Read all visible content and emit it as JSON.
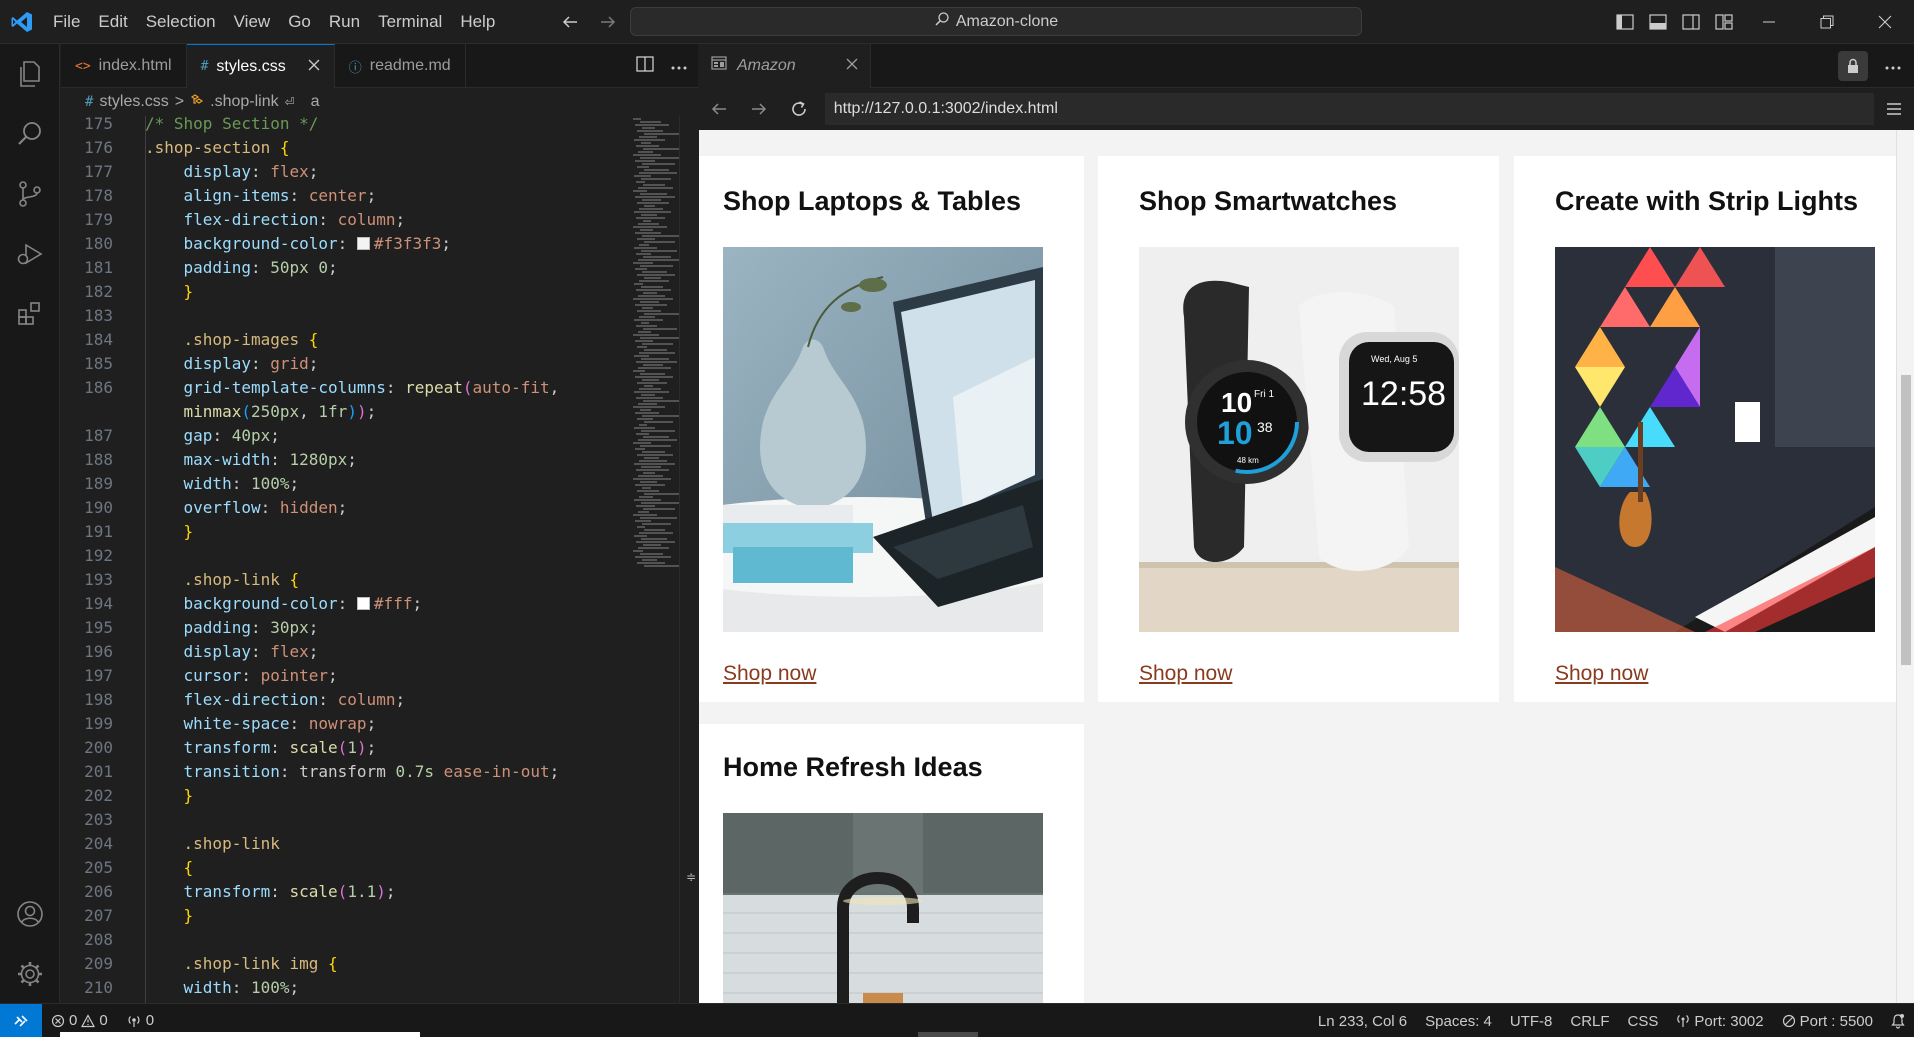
{
  "window": {
    "menu": [
      "File",
      "Edit",
      "Selection",
      "View",
      "Go",
      "Run",
      "Terminal",
      "Help"
    ],
    "search_text": "Amazon-clone"
  },
  "editor": {
    "tabs": [
      {
        "glyph": "<>",
        "label": "index.html",
        "color": "#e37933",
        "active": false
      },
      {
        "glyph": "#",
        "label": "styles.css",
        "color": "#519aba",
        "active": true
      },
      {
        "glyph": "ⓘ",
        "label": "readme.md",
        "color": "#519aba",
        "active": false
      }
    ],
    "breadcrumb": {
      "file": "styles.css",
      "sep": ">",
      "symbol": ".shop-link",
      "element": "a"
    },
    "lines": [
      {
        "n": "175",
        "tokens": [
          [
            "c-cm",
            "/* Shop Section */"
          ]
        ]
      },
      {
        "n": "176",
        "tokens": [
          [
            "c-sel",
            ".shop-section"
          ],
          [
            "c-pun",
            " "
          ],
          [
            "c-br",
            "{"
          ]
        ]
      },
      {
        "n": "177",
        "tokens": [
          [
            "c-prop",
            "    display"
          ],
          [
            "c-pun",
            ": "
          ],
          [
            "c-val",
            "flex"
          ],
          [
            "c-pun",
            ";"
          ]
        ]
      },
      {
        "n": "178",
        "tokens": [
          [
            "c-prop",
            "    align-items"
          ],
          [
            "c-pun",
            ": "
          ],
          [
            "c-val",
            "center"
          ],
          [
            "c-pun",
            ";"
          ]
        ]
      },
      {
        "n": "179",
        "tokens": [
          [
            "c-prop",
            "    flex-direction"
          ],
          [
            "c-pun",
            ": "
          ],
          [
            "c-val",
            "column"
          ],
          [
            "c-pun",
            ";"
          ]
        ]
      },
      {
        "n": "180",
        "tokens": [
          [
            "c-prop",
            "    background-color"
          ],
          [
            "c-pun",
            ": "
          ],
          [
            "swatch",
            "#f3f3f3"
          ],
          [
            "c-val",
            "#f3f3f3"
          ],
          [
            "c-pun",
            ";"
          ]
        ]
      },
      {
        "n": "181",
        "tokens": [
          [
            "c-prop",
            "    padding"
          ],
          [
            "c-pun",
            ": "
          ],
          [
            "c-num",
            "50px 0"
          ],
          [
            "c-pun",
            ";"
          ]
        ]
      },
      {
        "n": "182",
        "tokens": [
          [
            "c-br",
            "    }"
          ]
        ]
      },
      {
        "n": "183",
        "tokens": []
      },
      {
        "n": "184",
        "tokens": [
          [
            "c-sel",
            "    .shop-images"
          ],
          [
            "c-pun",
            " "
          ],
          [
            "c-br",
            "{"
          ]
        ]
      },
      {
        "n": "185",
        "tokens": [
          [
            "c-prop",
            "    display"
          ],
          [
            "c-pun",
            ": "
          ],
          [
            "c-val",
            "grid"
          ],
          [
            "c-pun",
            ";"
          ]
        ]
      },
      {
        "n": "186",
        "tokens": [
          [
            "c-prop",
            "    grid-template-columns"
          ],
          [
            "c-pun",
            ": "
          ],
          [
            "c-fn",
            "repeat"
          ],
          [
            "c-br2",
            "("
          ],
          [
            "c-val",
            "auto-fit"
          ],
          [
            "c-pun",
            ","
          ]
        ]
      },
      {
        "n": "",
        "tokens": [
          [
            "c-fn",
            "    minmax"
          ],
          [
            "c-br3",
            "("
          ],
          [
            "c-num",
            "250px"
          ],
          [
            "c-pun",
            ", "
          ],
          [
            "c-num",
            "1fr"
          ],
          [
            "c-br3",
            ")"
          ],
          [
            "c-br2",
            ")"
          ],
          [
            "c-pun",
            ";"
          ]
        ]
      },
      {
        "n": "187",
        "tokens": [
          [
            "c-prop",
            "    gap"
          ],
          [
            "c-pun",
            ": "
          ],
          [
            "c-num",
            "40px"
          ],
          [
            "c-pun",
            ";"
          ]
        ]
      },
      {
        "n": "188",
        "tokens": [
          [
            "c-prop",
            "    max-width"
          ],
          [
            "c-pun",
            ": "
          ],
          [
            "c-num",
            "1280px"
          ],
          [
            "c-pun",
            ";"
          ]
        ]
      },
      {
        "n": "189",
        "tokens": [
          [
            "c-prop",
            "    width"
          ],
          [
            "c-pun",
            ": "
          ],
          [
            "c-num",
            "100%"
          ],
          [
            "c-pun",
            ";"
          ]
        ]
      },
      {
        "n": "190",
        "tokens": [
          [
            "c-prop",
            "    overflow"
          ],
          [
            "c-pun",
            ": "
          ],
          [
            "c-val",
            "hidden"
          ],
          [
            "c-pun",
            ";"
          ]
        ]
      },
      {
        "n": "191",
        "tokens": [
          [
            "c-br",
            "    }"
          ]
        ]
      },
      {
        "n": "192",
        "tokens": []
      },
      {
        "n": "193",
        "tokens": [
          [
            "c-sel",
            "    .shop-link"
          ],
          [
            "c-pun",
            " "
          ],
          [
            "c-br",
            "{"
          ]
        ]
      },
      {
        "n": "194",
        "tokens": [
          [
            "c-prop",
            "    background-color"
          ],
          [
            "c-pun",
            ": "
          ],
          [
            "swatch",
            "#ffffff"
          ],
          [
            "c-val",
            "#fff"
          ],
          [
            "c-pun",
            ";"
          ]
        ]
      },
      {
        "n": "195",
        "tokens": [
          [
            "c-prop",
            "    padding"
          ],
          [
            "c-pun",
            ": "
          ],
          [
            "c-num",
            "30px"
          ],
          [
            "c-pun",
            ";"
          ]
        ]
      },
      {
        "n": "196",
        "tokens": [
          [
            "c-prop",
            "    display"
          ],
          [
            "c-pun",
            ": "
          ],
          [
            "c-val",
            "flex"
          ],
          [
            "c-pun",
            ";"
          ]
        ]
      },
      {
        "n": "197",
        "tokens": [
          [
            "c-prop",
            "    cursor"
          ],
          [
            "c-pun",
            ": "
          ],
          [
            "c-val",
            "pointer"
          ],
          [
            "c-pun",
            ";"
          ]
        ]
      },
      {
        "n": "198",
        "tokens": [
          [
            "c-prop",
            "    flex-direction"
          ],
          [
            "c-pun",
            ": "
          ],
          [
            "c-val",
            "column"
          ],
          [
            "c-pun",
            ";"
          ]
        ]
      },
      {
        "n": "199",
        "tokens": [
          [
            "c-prop",
            "    white-space"
          ],
          [
            "c-pun",
            ": "
          ],
          [
            "c-val",
            "nowrap"
          ],
          [
            "c-pun",
            ";"
          ]
        ]
      },
      {
        "n": "200",
        "tokens": [
          [
            "c-prop",
            "    transform"
          ],
          [
            "c-pun",
            ": "
          ],
          [
            "c-fn",
            "scale"
          ],
          [
            "c-br2",
            "("
          ],
          [
            "c-num",
            "1"
          ],
          [
            "c-br2",
            ")"
          ],
          [
            "c-pun",
            ";"
          ]
        ]
      },
      {
        "n": "201",
        "tokens": [
          [
            "c-prop",
            "    transition"
          ],
          [
            "c-pun",
            ": transform "
          ],
          [
            "c-num",
            "0.7s"
          ],
          [
            "c-pun",
            " "
          ],
          [
            "c-val",
            "ease-in-out"
          ],
          [
            "c-pun",
            ";"
          ]
        ]
      },
      {
        "n": "202",
        "tokens": [
          [
            "c-br",
            "    }"
          ]
        ]
      },
      {
        "n": "203",
        "tokens": []
      },
      {
        "n": "204",
        "tokens": [
          [
            "c-sel",
            "    .shop-link"
          ]
        ]
      },
      {
        "n": "205",
        "tokens": [
          [
            "c-br",
            "    {"
          ]
        ]
      },
      {
        "n": "206",
        "tokens": [
          [
            "c-prop",
            "    transform"
          ],
          [
            "c-pun",
            ": "
          ],
          [
            "c-fn",
            "scale"
          ],
          [
            "c-br2",
            "("
          ],
          [
            "c-num",
            "1.1"
          ],
          [
            "c-br2",
            ")"
          ],
          [
            "c-pun",
            ";"
          ]
        ]
      },
      {
        "n": "207",
        "tokens": [
          [
            "c-br",
            "    }"
          ]
        ]
      },
      {
        "n": "208",
        "tokens": []
      },
      {
        "n": "209",
        "tokens": [
          [
            "c-sel",
            "    .shop-link img"
          ],
          [
            "c-pun",
            " "
          ],
          [
            "c-br",
            "{"
          ]
        ]
      },
      {
        "n": "210",
        "tokens": [
          [
            "c-prop",
            "    width"
          ],
          [
            "c-pun",
            ": "
          ],
          [
            "c-num",
            "100%"
          ],
          [
            "c-pun",
            ";"
          ]
        ]
      }
    ]
  },
  "browser": {
    "tab_label": "Amazon",
    "url": "http://127.0.0.1:3002/index.html",
    "cards": [
      {
        "title": "Shop Laptops & Tables",
        "link": "Shop now",
        "image": "laptop-vase-photo"
      },
      {
        "title": "Shop Smartwatches",
        "link": "Shop now",
        "image": "smartwatches-photo"
      },
      {
        "title": "Create with Strip Lights",
        "link": "Shop now",
        "image": "strip-lights-photo"
      },
      {
        "title": "Home Refresh Ideas",
        "link": "",
        "image": "kitchen-faucet-photo"
      }
    ],
    "watch_face": {
      "big": "10",
      "small": "10",
      "date": "Fri 1",
      "num38": "38",
      "km": "48 km"
    },
    "watch_face2": {
      "time": "12:58",
      "date": "Wed, Aug 5"
    }
  },
  "statusbar": {
    "errors": "0",
    "warnings": "0",
    "ports": "0",
    "position": "Ln 233, Col 6",
    "spaces": "Spaces: 4",
    "encoding": "UTF-8",
    "eol": "CRLF",
    "language": "CSS",
    "port": "Port: 3002",
    "live_port": "Port : 5500"
  },
  "colors": {
    "accent": "#0078d4",
    "link": "#8a3a1e",
    "page_bg": "#f3f3f3"
  }
}
